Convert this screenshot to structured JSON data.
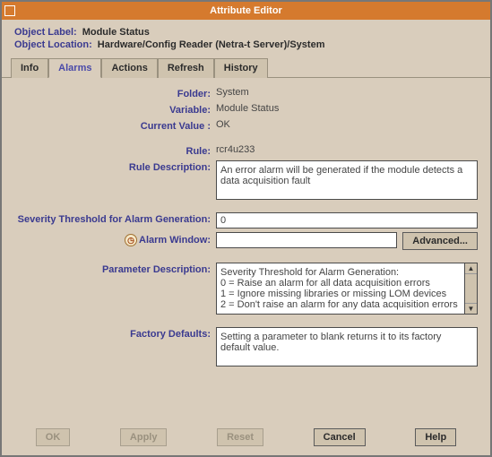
{
  "window": {
    "title": "Attribute Editor"
  },
  "header": {
    "label_label": "Object Label:",
    "label_value": "Module Status",
    "location_label": "Object Location:",
    "location_value": "Hardware/Config Reader (Netra-t Server)/System"
  },
  "tabs": {
    "info": "Info",
    "alarms": "Alarms",
    "actions": "Actions",
    "refresh": "Refresh",
    "history": "History"
  },
  "fields": {
    "folder_label": "Folder:",
    "folder_value": "System",
    "variable_label": "Variable:",
    "variable_value": "Module Status",
    "curval_label": "Current Value :",
    "curval_value": "OK",
    "rule_label": "Rule:",
    "rule_value": "rcr4u233",
    "ruledesc_label": "Rule Description:",
    "ruledesc_value": "An error alarm will be generated if the module detects a data acquisition fault",
    "sev_label": "Severity Threshold for Alarm Generation:",
    "sev_value": "0",
    "alarmwin_label": "Alarm Window:",
    "alarmwin_value": "",
    "advanced_btn": "Advanced...",
    "paramdesc_label": "Parameter Description:",
    "paramdesc_lines": [
      "Severity Threshold for Alarm Generation:",
      "0 = Raise an alarm for all data acquisition errors",
      "1 = Ignore missing libraries or missing LOM devices",
      "2 = Don't raise an alarm for any data acquisition errors"
    ],
    "factory_label": "Factory Defaults:",
    "factory_value": "Setting a parameter to blank returns it to its factory default value."
  },
  "buttons": {
    "ok": "OK",
    "apply": "Apply",
    "reset": "Reset",
    "cancel": "Cancel",
    "help": "Help"
  }
}
